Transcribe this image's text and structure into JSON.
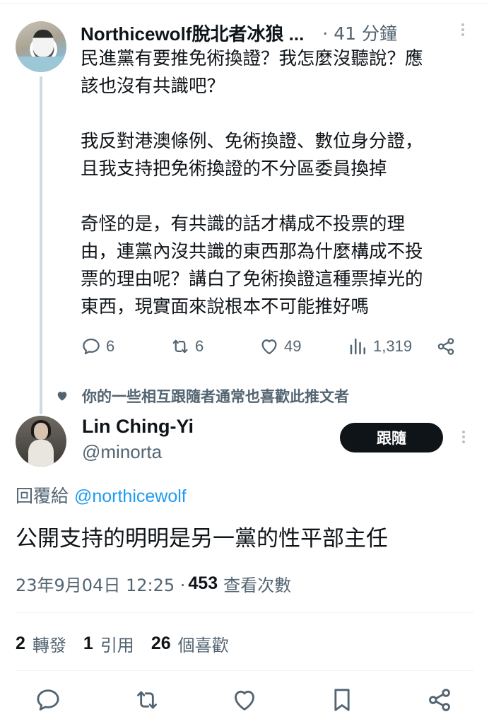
{
  "parent_tweet": {
    "author_name": "Northicewolf脫北者冰狼 ...",
    "time": "· 41 分鐘",
    "paragraphs": [
      [
        "民進黨有要推免術換證？我怎麼沒聽說？應",
        "該也沒有共識吧？"
      ],
      [
        "我反對港澳條例、免術換證、數位身分證，",
        "且我支持把免術換證的不分區委員換掉"
      ],
      [
        "奇怪的是，有共識的話才構成不投票的理",
        "由，連黨內沒共識的東西那為什麼構成不投",
        "票的理由呢？講白了免術換證這種票掉光的",
        "東西，現實面來說根本不可能推好嗎"
      ]
    ],
    "replies": "6",
    "reposts": "6",
    "likes": "49",
    "views": "1,319"
  },
  "social_context": "你的一些相互跟隨者通常也喜歡此推文者",
  "reply_tweet": {
    "author_name": "Lin Ching-Yi",
    "handle": "@minorta",
    "follow_label": "跟隨",
    "replying_prefix": "回覆給 ",
    "replying_to": "@northicewolf",
    "text": "公開支持的明明是另一黨的性平部主任",
    "timestamp": "23年9月04日 12:25 · ",
    "view_count": "453",
    "view_label": "查看次數"
  },
  "stats": {
    "reposts_count": "2",
    "reposts_label": "轉發",
    "quotes_count": "1",
    "quotes_label": "引用",
    "likes_count": "26",
    "likes_label": "個喜歡"
  },
  "icons": {
    "reply": "reply-icon",
    "repost": "repost-icon",
    "like": "heart-icon",
    "views": "views-icon",
    "share": "share-icon",
    "bookmark": "bookmark-icon",
    "more": "more-icon"
  },
  "colors": {
    "accent": "#1d9bf0",
    "text_primary": "#0f1419",
    "text_secondary": "#536471",
    "button_bg": "#0f1419"
  }
}
